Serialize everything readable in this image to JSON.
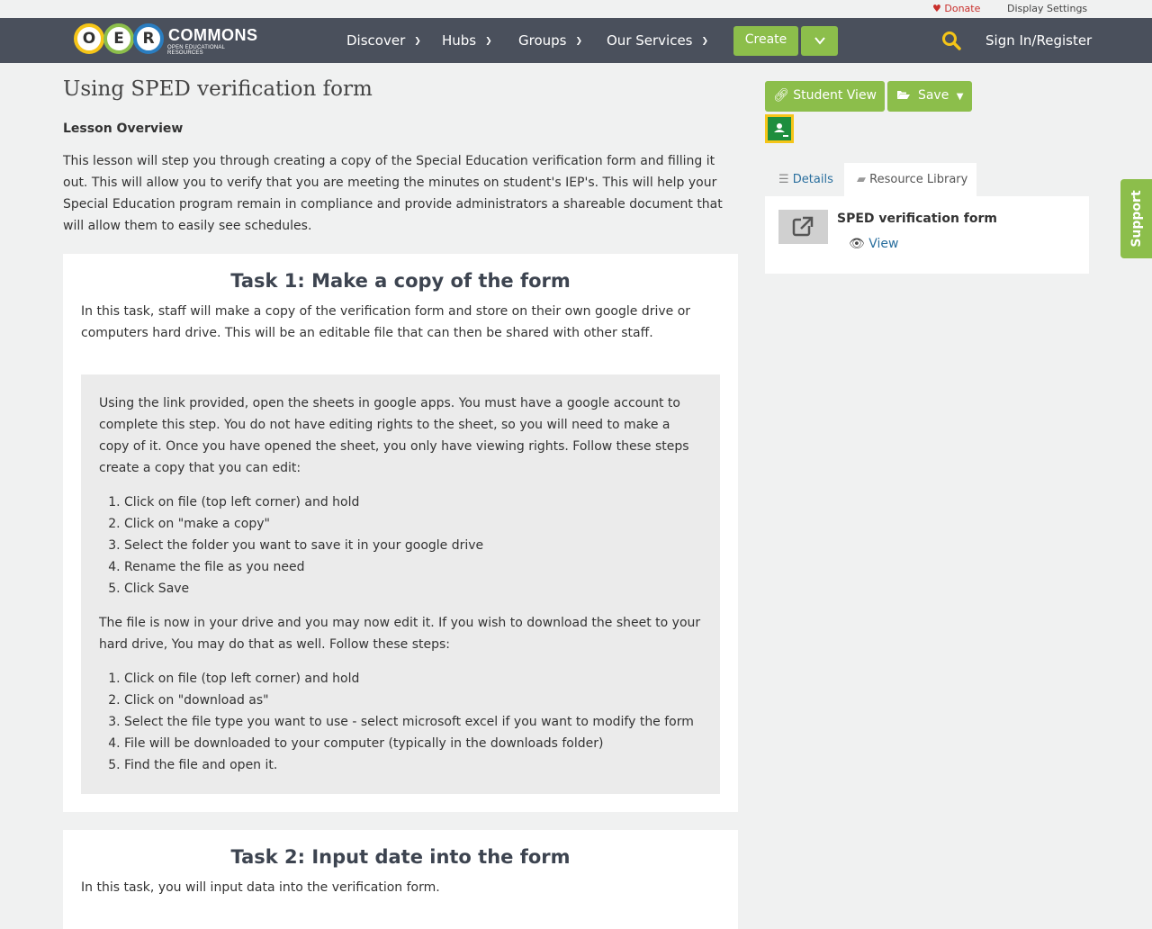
{
  "topbar": {
    "donate": "Donate",
    "display_settings": "Display Settings"
  },
  "logo": {
    "letters": [
      "O",
      "E",
      "R"
    ],
    "brand": "COMMONS",
    "tagline": "OPEN EDUCATIONAL RESOURCES"
  },
  "nav": {
    "items": [
      {
        "label": "Discover"
      },
      {
        "label": "Hubs"
      },
      {
        "label": "Groups"
      },
      {
        "label": "Our Services"
      }
    ],
    "create": "Create",
    "signin": "Sign In/Register"
  },
  "page": {
    "title": "Using SPED verification form",
    "overview_heading": "Lesson Overview",
    "overview_text": "This lesson will step you through creating a copy of the Special Education verification form and filling it out.  This will allow you to verify that you are meeting the minutes on student's IEP's.  This will help your Special Education program remain in compliance and provide administrators a shareable document that will allow them to easily see schedules."
  },
  "task1": {
    "title": "Task 1: Make a copy of the form",
    "intro": "In this task, staff will make a copy of the verification form and store on their own google drive or computers hard drive. This will be an editable file that can then be shared with other staff.",
    "para1": "Using the link provided, open the sheets in google apps.  You must have a google account to complete this step.  You do not have editing rights to the sheet, so you will need to make a copy of it.   Once you have opened the sheet, you only have viewing rights.  Follow these steps create a copy that you can edit:",
    "steps1": [
      "Click on file (top left corner) and hold",
      "Click on \"make a copy\"",
      "Select the folder you want to save it in your google drive",
      "Rename the file as you need",
      "Click Save"
    ],
    "para2": "The file is now in your drive and you may now edit it.  If you wish to download the sheet to your hard drive, You may do that as well.  Follow these steps:",
    "steps2": [
      "Click on file (top left corner) and hold",
      "Click on \"download as\"",
      "Select the file type you want to use - select microsoft excel if you want to modify the form",
      "File will be downloaded to your computer (typically in the downloads folder)",
      "Find the file and open it."
    ]
  },
  "task2": {
    "title": "Task 2: Input date into the form",
    "intro": "In this task, you will input data into the verification form."
  },
  "sidebar": {
    "student_view": "Student View",
    "save": "Save",
    "tabs": {
      "details": "Details",
      "library": "Resource Library"
    },
    "resource": {
      "title": "SPED verification form",
      "view": "View"
    }
  },
  "support": "Support",
  "colors": {
    "nav_bg": "#4a505c",
    "accent_green": "#8cbe4b",
    "link_blue": "#2a6f9e",
    "donate_red": "#c9302c"
  }
}
